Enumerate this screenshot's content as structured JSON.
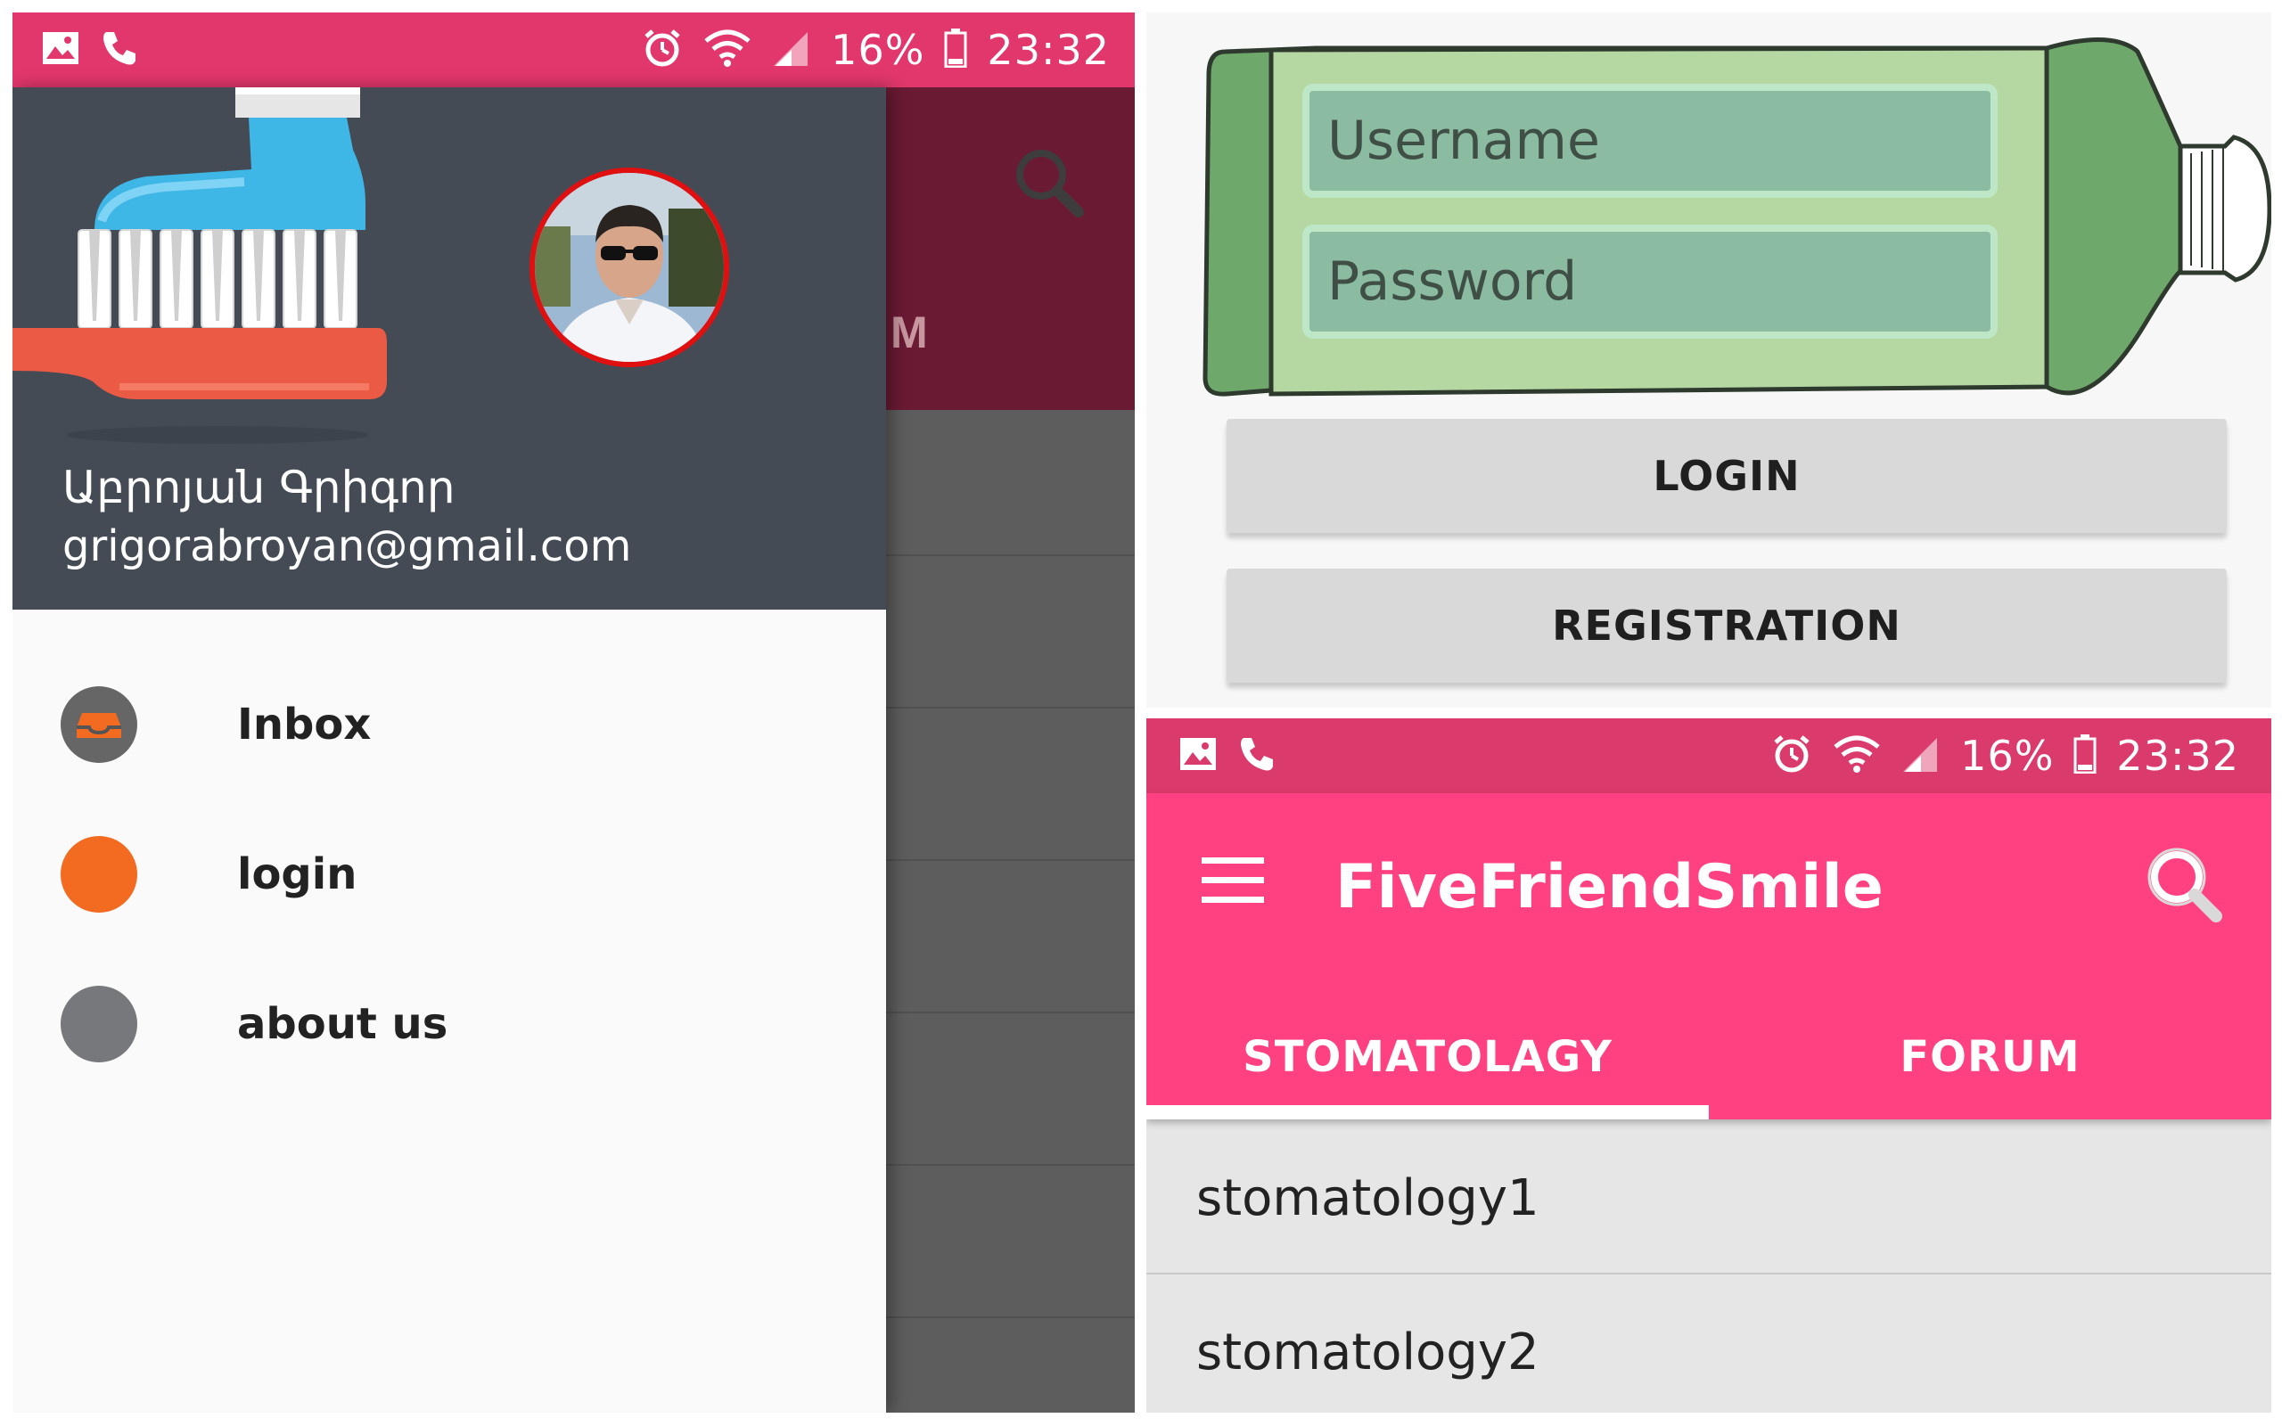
{
  "status_bar": {
    "battery": "16%",
    "time": "23:32"
  },
  "background_app": {
    "tab_fragment": "M"
  },
  "drawer": {
    "user_name": "Աբրոյան Գրիգոր",
    "user_email": "grigorabroyan@gmail.com",
    "items": [
      {
        "label": "Inbox",
        "icon": "inbox-icon",
        "color": "#666666"
      },
      {
        "label": "login",
        "icon": "circle-icon",
        "color": "#f26b21"
      },
      {
        "label": "about us",
        "icon": "circle-icon",
        "color": "#77787c"
      }
    ]
  },
  "login": {
    "username_placeholder": "Username",
    "password_placeholder": "Password",
    "login_label": "LOGIN",
    "registration_label": "REGISTRATION"
  },
  "app": {
    "title": "FiveFriendSmile",
    "tabs": [
      {
        "label": "STOMATOLAGY",
        "selected": true
      },
      {
        "label": "FORUM",
        "selected": false
      }
    ],
    "list": [
      "stomatology1",
      "stomatology2"
    ]
  },
  "colors": {
    "status_left": "#e2376c",
    "status_right": "#db3a6c",
    "accent_pink": "#ff4081",
    "drawer_header": "#444b55",
    "background_toolbar": "#6b1a34"
  }
}
